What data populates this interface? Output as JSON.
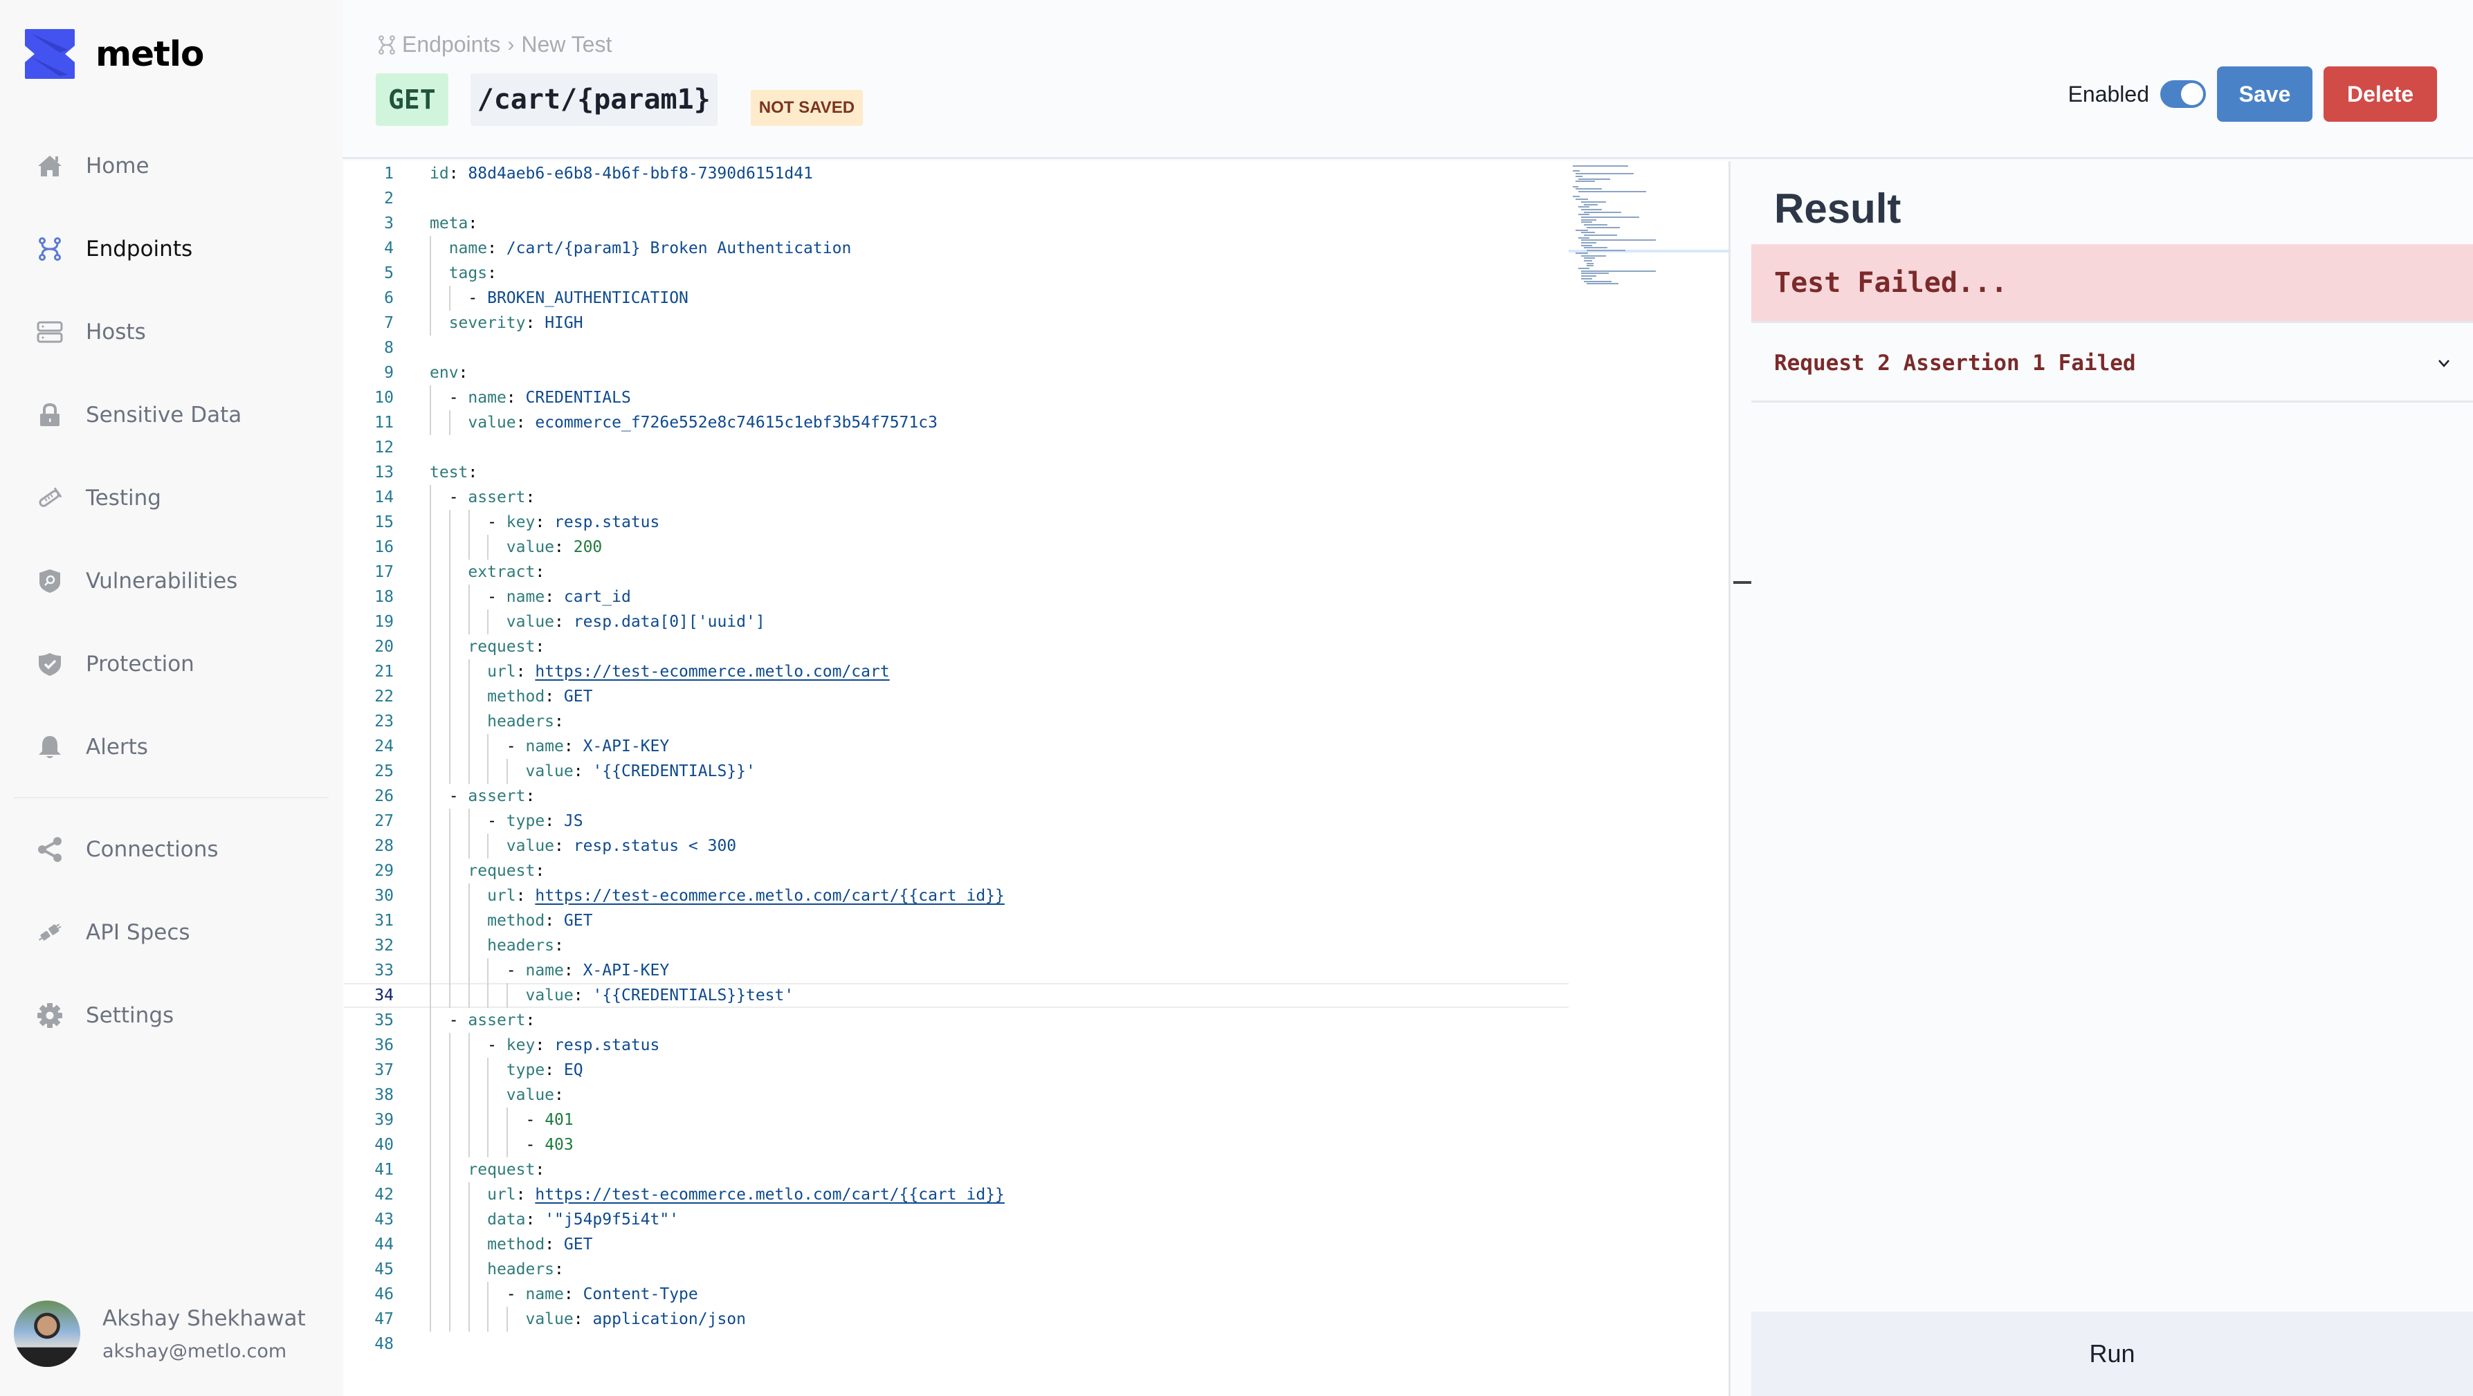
{
  "brand": {
    "name": "metlo",
    "color": "#4353f0"
  },
  "sidebar": {
    "items": [
      {
        "label": "Home",
        "icon": "home-icon",
        "active": false
      },
      {
        "label": "Endpoints",
        "icon": "endpoints-icon",
        "active": true
      },
      {
        "label": "Hosts",
        "icon": "hosts-icon",
        "active": false
      },
      {
        "label": "Sensitive Data",
        "icon": "lock-icon",
        "active": false
      },
      {
        "label": "Testing",
        "icon": "test-tube-icon",
        "active": false
      },
      {
        "label": "Vulnerabilities",
        "icon": "shield-search-icon",
        "active": false
      },
      {
        "label": "Protection",
        "icon": "shield-check-icon",
        "active": false
      },
      {
        "label": "Alerts",
        "icon": "bell-icon",
        "active": false
      }
    ],
    "secondary_items": [
      {
        "label": "Connections",
        "icon": "share-icon"
      },
      {
        "label": "API Specs",
        "icon": "plug-icon"
      },
      {
        "label": "Settings",
        "icon": "gear-icon"
      }
    ],
    "user": {
      "name": "Akshay Shekhawat",
      "email": "akshay@metlo.com"
    }
  },
  "header": {
    "breadcrumb": [
      "Endpoints",
      "New Test"
    ],
    "method": "GET",
    "path": "/cart/{param1}",
    "status": "NOT SAVED",
    "enabled_label": "Enabled",
    "enabled": true,
    "save_label": "Save",
    "delete_label": "Delete"
  },
  "editor": {
    "current_line": 34,
    "lines": [
      [
        [
          "k",
          "id"
        ],
        [
          "p",
          ": "
        ],
        [
          "s",
          "88d4aeb6-e6b8-4b6f-bbf8-7390d6151d41"
        ]
      ],
      [],
      [
        [
          "k",
          "meta"
        ],
        [
          "p",
          ":"
        ]
      ],
      [
        [
          "i",
          "  "
        ],
        [
          "k",
          "name"
        ],
        [
          "p",
          ": "
        ],
        [
          "s",
          "/cart/{param1} Broken Authentication"
        ]
      ],
      [
        [
          "i",
          "  "
        ],
        [
          "k",
          "tags"
        ],
        [
          "p",
          ":"
        ]
      ],
      [
        [
          "i",
          "    "
        ],
        [
          "p",
          "- "
        ],
        [
          "s",
          "BROKEN_AUTHENTICATION"
        ]
      ],
      [
        [
          "i",
          "  "
        ],
        [
          "k",
          "severity"
        ],
        [
          "p",
          ": "
        ],
        [
          "s",
          "HIGH"
        ]
      ],
      [],
      [
        [
          "k",
          "env"
        ],
        [
          "p",
          ":"
        ]
      ],
      [
        [
          "i",
          "  "
        ],
        [
          "p",
          "- "
        ],
        [
          "k",
          "name"
        ],
        [
          "p",
          ": "
        ],
        [
          "s",
          "CREDENTIALS"
        ]
      ],
      [
        [
          "i",
          "    "
        ],
        [
          "k",
          "value"
        ],
        [
          "p",
          ": "
        ],
        [
          "s",
          "ecommerce_f726e552e8c74615c1ebf3b54f7571c3"
        ]
      ],
      [],
      [
        [
          "k",
          "test"
        ],
        [
          "p",
          ":"
        ]
      ],
      [
        [
          "i",
          "  "
        ],
        [
          "p",
          "- "
        ],
        [
          "k",
          "assert"
        ],
        [
          "p",
          ":"
        ]
      ],
      [
        [
          "i",
          "      "
        ],
        [
          "p",
          "- "
        ],
        [
          "k",
          "key"
        ],
        [
          "p",
          ": "
        ],
        [
          "s",
          "resp.status"
        ]
      ],
      [
        [
          "i",
          "        "
        ],
        [
          "k",
          "value"
        ],
        [
          "p",
          ": "
        ],
        [
          "n",
          "200"
        ]
      ],
      [
        [
          "i",
          "    "
        ],
        [
          "k",
          "extract"
        ],
        [
          "p",
          ":"
        ]
      ],
      [
        [
          "i",
          "      "
        ],
        [
          "p",
          "- "
        ],
        [
          "k",
          "name"
        ],
        [
          "p",
          ": "
        ],
        [
          "s",
          "cart_id"
        ]
      ],
      [
        [
          "i",
          "        "
        ],
        [
          "k",
          "value"
        ],
        [
          "p",
          ": "
        ],
        [
          "s",
          "resp.data[0]['uuid']"
        ]
      ],
      [
        [
          "i",
          "    "
        ],
        [
          "k",
          "request"
        ],
        [
          "p",
          ":"
        ]
      ],
      [
        [
          "i",
          "      "
        ],
        [
          "k",
          "url"
        ],
        [
          "p",
          ": "
        ],
        [
          "u",
          "https://test-ecommerce.metlo.com/cart"
        ]
      ],
      [
        [
          "i",
          "      "
        ],
        [
          "k",
          "method"
        ],
        [
          "p",
          ": "
        ],
        [
          "s",
          "GET"
        ]
      ],
      [
        [
          "i",
          "      "
        ],
        [
          "k",
          "headers"
        ],
        [
          "p",
          ":"
        ]
      ],
      [
        [
          "i",
          "        "
        ],
        [
          "p",
          "- "
        ],
        [
          "k",
          "name"
        ],
        [
          "p",
          ": "
        ],
        [
          "s",
          "X-API-KEY"
        ]
      ],
      [
        [
          "i",
          "          "
        ],
        [
          "k",
          "value"
        ],
        [
          "p",
          ": "
        ],
        [
          "s",
          "'{{CREDENTIALS}}'"
        ]
      ],
      [
        [
          "i",
          "  "
        ],
        [
          "p",
          "- "
        ],
        [
          "k",
          "assert"
        ],
        [
          "p",
          ":"
        ]
      ],
      [
        [
          "i",
          "      "
        ],
        [
          "p",
          "- "
        ],
        [
          "k",
          "type"
        ],
        [
          "p",
          ": "
        ],
        [
          "s",
          "JS"
        ]
      ],
      [
        [
          "i",
          "        "
        ],
        [
          "k",
          "value"
        ],
        [
          "p",
          ": "
        ],
        [
          "s",
          "resp.status < 300"
        ]
      ],
      [
        [
          "i",
          "    "
        ],
        [
          "k",
          "request"
        ],
        [
          "p",
          ":"
        ]
      ],
      [
        [
          "i",
          "      "
        ],
        [
          "k",
          "url"
        ],
        [
          "p",
          ": "
        ],
        [
          "u",
          "https://test-ecommerce.metlo.com/cart/{{cart_id}}"
        ]
      ],
      [
        [
          "i",
          "      "
        ],
        [
          "k",
          "method"
        ],
        [
          "p",
          ": "
        ],
        [
          "s",
          "GET"
        ]
      ],
      [
        [
          "i",
          "      "
        ],
        [
          "k",
          "headers"
        ],
        [
          "p",
          ":"
        ]
      ],
      [
        [
          "i",
          "        "
        ],
        [
          "p",
          "- "
        ],
        [
          "k",
          "name"
        ],
        [
          "p",
          ": "
        ],
        [
          "s",
          "X-API-KEY"
        ]
      ],
      [
        [
          "i",
          "          "
        ],
        [
          "k",
          "value"
        ],
        [
          "p",
          ": "
        ],
        [
          "s",
          "'{{CREDENTIALS}}test'"
        ]
      ],
      [
        [
          "i",
          "  "
        ],
        [
          "p",
          "- "
        ],
        [
          "k",
          "assert"
        ],
        [
          "p",
          ":"
        ]
      ],
      [
        [
          "i",
          "      "
        ],
        [
          "p",
          "- "
        ],
        [
          "k",
          "key"
        ],
        [
          "p",
          ": "
        ],
        [
          "s",
          "resp.status"
        ]
      ],
      [
        [
          "i",
          "        "
        ],
        [
          "k",
          "type"
        ],
        [
          "p",
          ": "
        ],
        [
          "s",
          "EQ"
        ]
      ],
      [
        [
          "i",
          "        "
        ],
        [
          "k",
          "value"
        ],
        [
          "p",
          ":"
        ]
      ],
      [
        [
          "i",
          "          "
        ],
        [
          "p",
          "- "
        ],
        [
          "n",
          "401"
        ]
      ],
      [
        [
          "i",
          "          "
        ],
        [
          "p",
          "- "
        ],
        [
          "n",
          "403"
        ]
      ],
      [
        [
          "i",
          "    "
        ],
        [
          "k",
          "request"
        ],
        [
          "p",
          ":"
        ]
      ],
      [
        [
          "i",
          "      "
        ],
        [
          "k",
          "url"
        ],
        [
          "p",
          ": "
        ],
        [
          "u",
          "https://test-ecommerce.metlo.com/cart/{{cart_id}}"
        ]
      ],
      [
        [
          "i",
          "      "
        ],
        [
          "k",
          "data"
        ],
        [
          "p",
          ": "
        ],
        [
          "s",
          "'\"j54p9f5i4t\"'"
        ]
      ],
      [
        [
          "i",
          "      "
        ],
        [
          "k",
          "method"
        ],
        [
          "p",
          ": "
        ],
        [
          "s",
          "GET"
        ]
      ],
      [
        [
          "i",
          "      "
        ],
        [
          "k",
          "headers"
        ],
        [
          "p",
          ":"
        ]
      ],
      [
        [
          "i",
          "        "
        ],
        [
          "p",
          "- "
        ],
        [
          "k",
          "name"
        ],
        [
          "p",
          ": "
        ],
        [
          "s",
          "Content-Type"
        ]
      ],
      [
        [
          "i",
          "          "
        ],
        [
          "k",
          "value"
        ],
        [
          "p",
          ": "
        ],
        [
          "s",
          "application/json"
        ]
      ],
      []
    ]
  },
  "result": {
    "title": "Result",
    "status_text": "Test Failed...",
    "assertions": [
      {
        "label": "Request 2 Assertion 1 Failed",
        "expanded": false
      }
    ],
    "run_label": "Run"
  },
  "colors": {
    "accent": "#4a82c8",
    "danger": "#d14b47",
    "method_bg": "#d1f5dc",
    "not_saved_bg": "#fdebcc",
    "fail_bg": "#f8d7da",
    "fail_text": "#7b2a2a"
  }
}
